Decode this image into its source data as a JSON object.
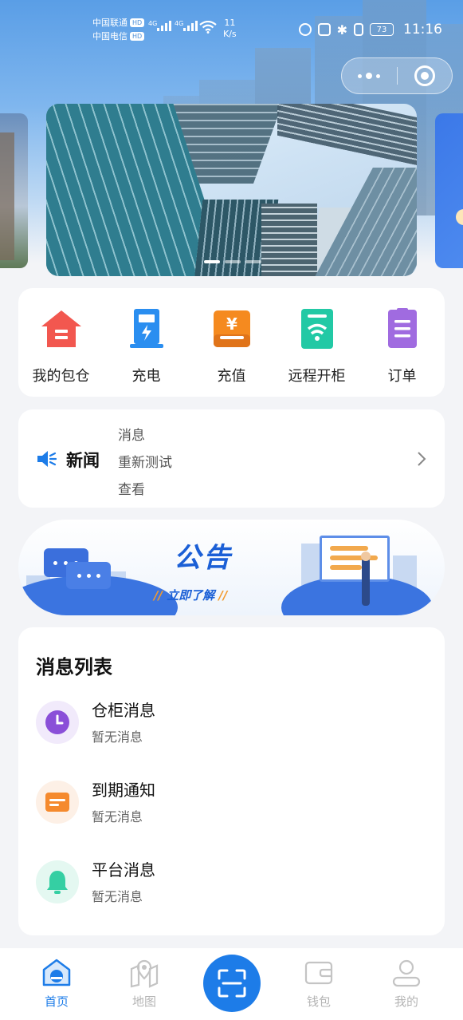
{
  "status_bar": {
    "carrier_1": "中国联通",
    "carrier_2": "中国电信",
    "hd_badge": "HD",
    "network_1": "4G",
    "network_2": "4G",
    "speed_value": "11",
    "speed_unit": "K/s",
    "battery": "73",
    "time": "11:16"
  },
  "menu": {
    "items": [
      {
        "label": "我的包仓",
        "icon": "warehouse-icon",
        "color": "#f2574f"
      },
      {
        "label": "充电",
        "icon": "charging-icon",
        "color": "#2a8ef0"
      },
      {
        "label": "充值",
        "icon": "recharge-icon",
        "color": "#f58a1f"
      },
      {
        "label": "远程开柜",
        "icon": "remote-cabinet-icon",
        "color": "#22c9a5"
      },
      {
        "label": "订单",
        "icon": "order-icon",
        "color": "#a06be0"
      }
    ]
  },
  "news": {
    "title": "新闻",
    "lines": [
      "消息",
      "重新测试",
      "查看"
    ]
  },
  "notice": {
    "title": "公告",
    "action": "立即了解"
  },
  "messages": {
    "header": "消息列表",
    "items": [
      {
        "title": "仓柜消息",
        "subtitle": "暂无消息",
        "icon": "clock-icon",
        "color": "#8a4fd8",
        "bg": "#f1eafb"
      },
      {
        "title": "到期通知",
        "subtitle": "暂无消息",
        "icon": "card-icon",
        "color": "#f58a2e",
        "bg": "#fdf0e6"
      },
      {
        "title": "平台消息",
        "subtitle": "暂无消息",
        "icon": "bell-icon",
        "color": "#35cfa3",
        "bg": "#e4f8f1"
      }
    ]
  },
  "tabbar": {
    "items": [
      {
        "label": "首页",
        "icon": "home-icon",
        "active": true
      },
      {
        "label": "地图",
        "icon": "map-icon",
        "active": false
      },
      {
        "label": "钱包",
        "icon": "wallet-icon",
        "active": false
      },
      {
        "label": "我的",
        "icon": "profile-icon",
        "active": false
      }
    ],
    "accent": "#1d7ce8"
  }
}
